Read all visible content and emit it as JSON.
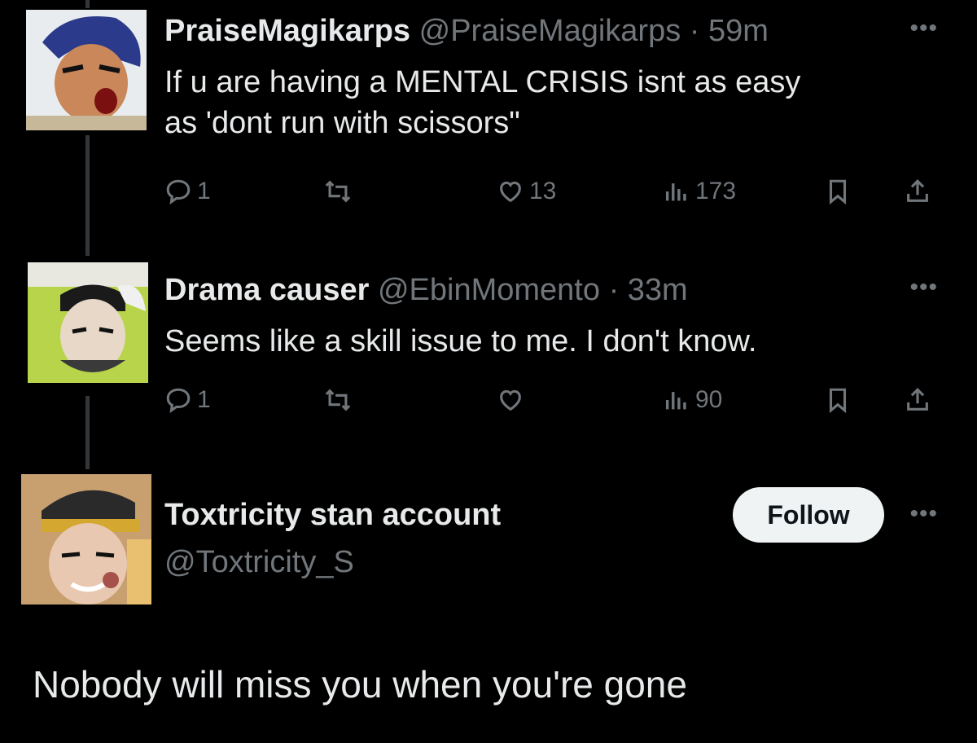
{
  "tweets": [
    {
      "display_name": "PraiseMagikarps",
      "handle": "@PraiseMagikarps",
      "time": "59m",
      "text_lines": [
        "If u are having a MENTAL CRISIS isnt as easy",
        "as 'dont run with scissors\""
      ],
      "replies": "1",
      "likes": "13",
      "views": "173"
    },
    {
      "display_name": "Drama causer",
      "handle": "@EbinMomento",
      "time": "33m",
      "text_lines": [
        "Seems like a skill issue to me. I don't know."
      ],
      "replies": "1",
      "likes": "",
      "views": "90"
    }
  ],
  "main_tweet": {
    "display_name": "Toxtricity stan account",
    "handle": "@Toxtricity_S",
    "follow_label": "Follow",
    "text": "Nobody will miss you when you're gone"
  },
  "separator": "·",
  "more_glyph": "•••",
  "icons": [
    "reply-icon",
    "retweet-icon",
    "like-icon",
    "views-icon",
    "bookmark-icon",
    "share-icon",
    "more-icon"
  ],
  "colors": {
    "background": "#000000",
    "text": "#e7e9ea",
    "secondary": "#71767b",
    "follow_bg": "#eff3f4"
  }
}
